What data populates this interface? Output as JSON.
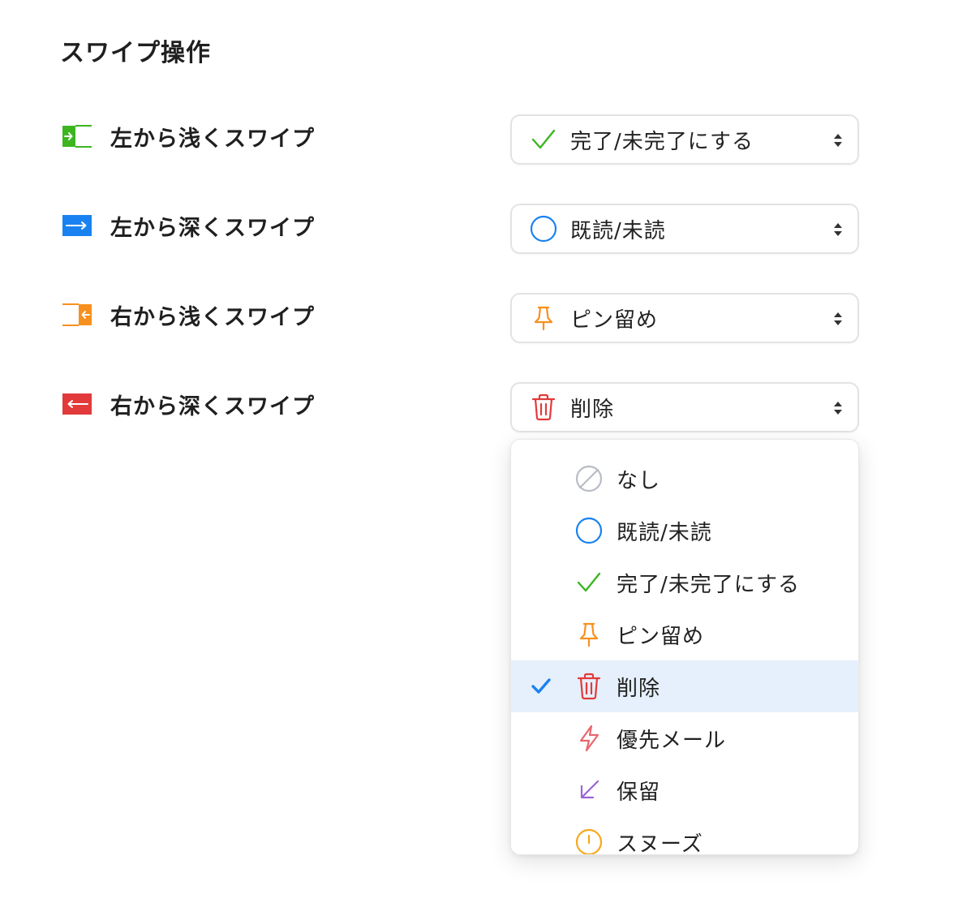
{
  "section_title": "スワイプ操作",
  "rows": [
    {
      "label": "左から浅くスワイプ",
      "icon": "swipe-left-short-icon",
      "color": "#3cb521",
      "selected_label": "完了/未完了にする",
      "selected_icon": "check-icon"
    },
    {
      "label": "左から深くスワイプ",
      "icon": "swipe-left-long-icon",
      "color": "#1a82f0",
      "selected_label": "既読/未読",
      "selected_icon": "circle-icon"
    },
    {
      "label": "右から浅くスワイプ",
      "icon": "swipe-right-short-icon",
      "color": "#f7901e",
      "selected_label": "ピン留め",
      "selected_icon": "pin-icon"
    },
    {
      "label": "右から深くスワイプ",
      "icon": "swipe-right-long-icon",
      "color": "#e23a3a",
      "selected_label": "削除",
      "selected_icon": "trash-icon"
    }
  ],
  "dropdown": {
    "options": [
      {
        "label": "なし",
        "icon": "none-icon",
        "color": "#b8bcc4"
      },
      {
        "label": "既読/未読",
        "icon": "circle-icon",
        "color": "#1a82f0"
      },
      {
        "label": "完了/未完了にする",
        "icon": "check-icon",
        "color": "#3cb521"
      },
      {
        "label": "ピン留め",
        "icon": "pin-icon",
        "color": "#f7901e"
      },
      {
        "label": "削除",
        "icon": "trash-icon",
        "color": "#e23a3a",
        "selected": true
      },
      {
        "label": "優先メール",
        "icon": "lightning-icon",
        "color": "#e8676e"
      },
      {
        "label": "保留",
        "icon": "arrow-down-left-icon",
        "color": "#9b64d6"
      },
      {
        "label": "スヌーズ",
        "icon": "clock-icon",
        "color": "#f7a81e"
      }
    ],
    "selected_check_color": "#1a82f0",
    "selected_bg": "#e6f0fc"
  }
}
